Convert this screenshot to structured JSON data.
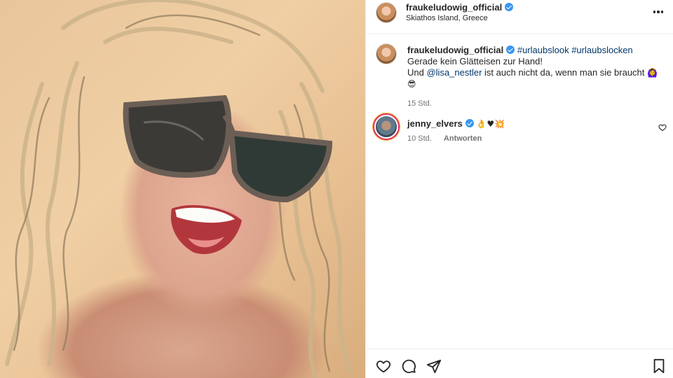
{
  "header": {
    "username": "fraukeludowig_official",
    "location": "Skiathos Island, Greece",
    "more_icon": "more-horizontal-icon"
  },
  "caption": {
    "username": "fraukeludowig_official",
    "hashtags": "#urlaubslook #urlaubslocken",
    "line1": "Gerade kein Glätteisen zur Hand!",
    "line2_start": "Und ",
    "mention": "@lisa_nestler",
    "line2_end": " ist auch nicht da, wenn man sie braucht",
    "emoji_1": "🙆‍♀️",
    "emoji_2": "😎",
    "time": "15 Std."
  },
  "comment": {
    "username": "jenny_elvers",
    "emojis": "👌♥💥",
    "time": "10 Std.",
    "reply_label": "Antworten"
  },
  "icons": {
    "verified": "verified-badge-icon",
    "like": "heart-icon",
    "comment": "comment-icon",
    "share": "send-icon",
    "save": "bookmark-icon"
  },
  "colors": {
    "verified": "#3897f0",
    "link": "#00376b",
    "meta": "#737373"
  }
}
